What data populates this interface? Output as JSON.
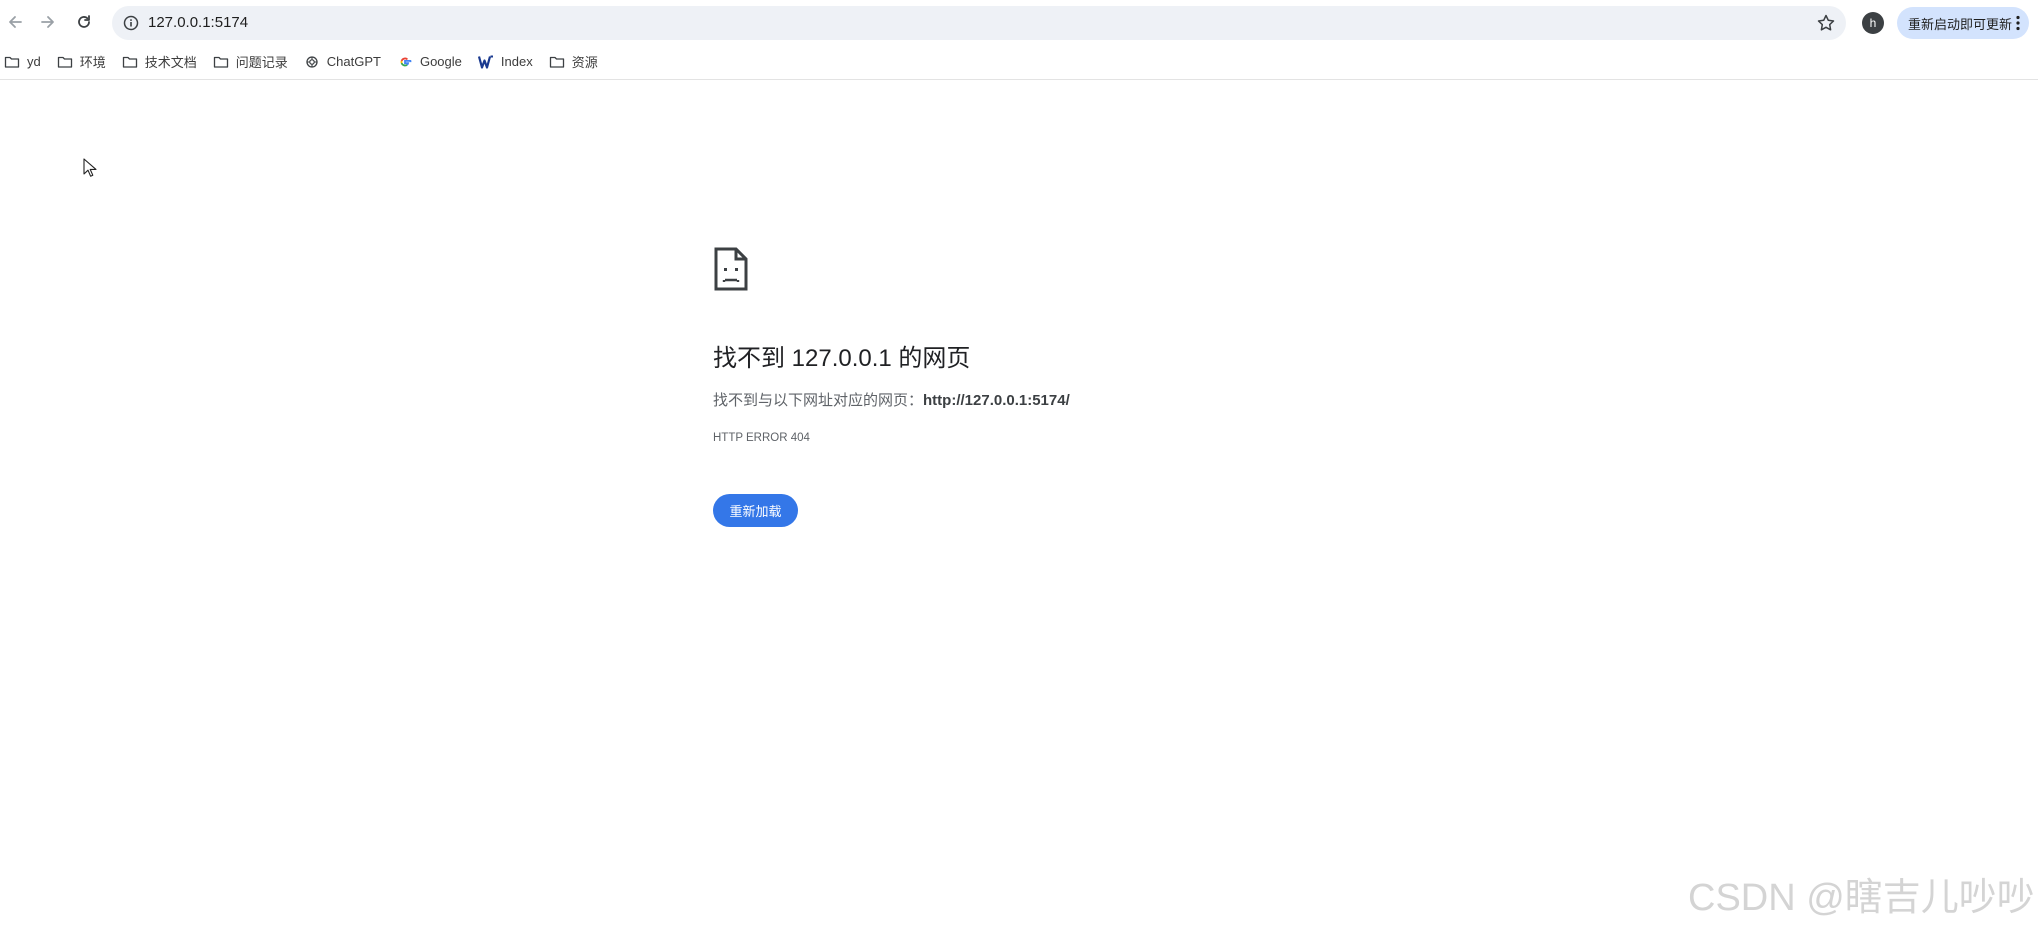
{
  "toolbar": {
    "url": "127.0.0.1:5174",
    "profile_initial": "h",
    "update_label": "重新启动即可更新"
  },
  "bookmarks": [
    {
      "icon": "folder-icon",
      "label": "yd"
    },
    {
      "icon": "folder-icon",
      "label": "环境"
    },
    {
      "icon": "folder-icon",
      "label": "技术文档"
    },
    {
      "icon": "folder-icon",
      "label": "问题记录"
    },
    {
      "icon": "chatgpt-icon",
      "label": "ChatGPT"
    },
    {
      "icon": "google-icon",
      "label": "Google"
    },
    {
      "icon": "w-logo-icon",
      "label": "Index"
    },
    {
      "icon": "folder-icon",
      "label": "资源"
    }
  ],
  "error": {
    "icon": "sad-page-icon",
    "title": "找不到 127.0.0.1 的网页",
    "desc_prefix": "找不到与以下网址对应的网页：",
    "desc_url": "http://127.0.0.1:5174/",
    "code": "HTTP ERROR 404",
    "reload_label": "重新加载"
  },
  "watermark": "CSDN @瞎吉儿吵吵",
  "colors": {
    "omnibox_bg": "#eef1f6",
    "update_bg": "#d3e3fd",
    "reload_bg": "#3477e8"
  }
}
